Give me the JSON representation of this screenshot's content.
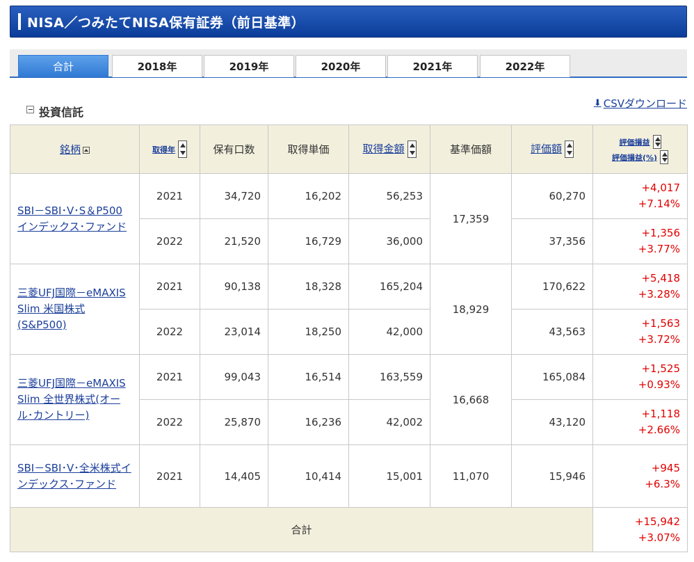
{
  "header": {
    "title": "NISA／つみたてNISA保有証券（前日基準）"
  },
  "tabs": [
    {
      "label": "合計",
      "active": true
    },
    {
      "label": "2018年",
      "active": false
    },
    {
      "label": "2019年",
      "active": false
    },
    {
      "label": "2020年",
      "active": false
    },
    {
      "label": "2021年",
      "active": false
    },
    {
      "label": "2022年",
      "active": false
    }
  ],
  "section": {
    "label": "投資信託",
    "csv_label": "CSVダウンロード"
  },
  "columns": {
    "fund": "銘柄",
    "year": "取得年",
    "units": "保有口数",
    "unit_cost": "取得単価",
    "cost": "取得金額",
    "nav": "基準価額",
    "value": "評価額",
    "pl": "評価損益",
    "pl_pct": "評価損益(%)"
  },
  "funds": [
    {
      "name": "SBI－SBI･V･S＆P500インデックス･ファンド",
      "nav": "17,359",
      "rows": [
        {
          "year": "2021",
          "units": "34,720",
          "unit_cost": "16,202",
          "cost": "56,253",
          "value": "60,270",
          "pl": "+4,017",
          "pl_pct": "+7.14%"
        },
        {
          "year": "2022",
          "units": "21,520",
          "unit_cost": "16,729",
          "cost": "36,000",
          "value": "37,356",
          "pl": "+1,356",
          "pl_pct": "+3.77%"
        }
      ]
    },
    {
      "name": "三菱UFJ国際－eMAXIS Slim 米国株式(S&P500)",
      "nav": "18,929",
      "rows": [
        {
          "year": "2021",
          "units": "90,138",
          "unit_cost": "18,328",
          "cost": "165,204",
          "value": "170,622",
          "pl": "+5,418",
          "pl_pct": "+3.28%"
        },
        {
          "year": "2022",
          "units": "23,014",
          "unit_cost": "18,250",
          "cost": "42,000",
          "value": "43,563",
          "pl": "+1,563",
          "pl_pct": "+3.72%"
        }
      ]
    },
    {
      "name": "三菱UFJ国際－eMAXIS Slim 全世界株式(オール･カントリー)",
      "nav": "16,668",
      "rows": [
        {
          "year": "2021",
          "units": "99,043",
          "unit_cost": "16,514",
          "cost": "163,559",
          "value": "165,084",
          "pl": "+1,525",
          "pl_pct": "+0.93%"
        },
        {
          "year": "2022",
          "units": "25,870",
          "unit_cost": "16,236",
          "cost": "42,002",
          "value": "43,120",
          "pl": "+1,118",
          "pl_pct": "+2.66%"
        }
      ]
    },
    {
      "name": "SBI－SBI･V･全米株式インデックス･ファンド",
      "nav": "11,070",
      "rows": [
        {
          "year": "2021",
          "units": "14,405",
          "unit_cost": "10,414",
          "cost": "15,001",
          "value": "15,946",
          "pl": "+945",
          "pl_pct": "+6.3%"
        }
      ]
    }
  ],
  "total": {
    "label": "合計",
    "pl": "+15,942",
    "pl_pct": "+3.07%"
  },
  "colors": {
    "title_bar": "#0b3d99",
    "tab_active": "#3079d4",
    "header_bg": "#f2efdc",
    "link": "#1b3f9b",
    "gain": "#e00000"
  }
}
